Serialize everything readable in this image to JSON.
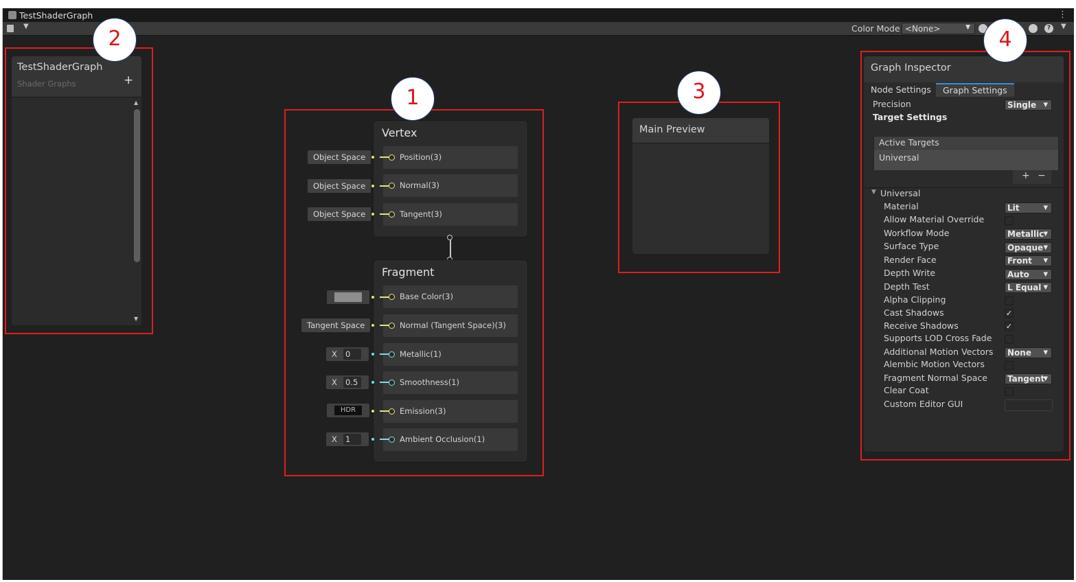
{
  "window": {
    "title": "TestShaderGraph",
    "menu_glyph": "⋮"
  },
  "toolbar": {
    "color_mode_label": "Color Mode",
    "color_mode_value": "<None>"
  },
  "blackboard": {
    "title": "TestShaderGraph",
    "subtitle": "Shader Graphs",
    "add_glyph": "+"
  },
  "vertex": {
    "title": "Vertex",
    "slots": [
      {
        "label": "Position(3)",
        "input": "Object Space"
      },
      {
        "label": "Normal(3)",
        "input": "Object Space"
      },
      {
        "label": "Tangent(3)",
        "input": "Object Space"
      }
    ]
  },
  "fragment": {
    "title": "Fragment",
    "slots": [
      {
        "label": "Base Color(3)",
        "input_type": "color-swatch"
      },
      {
        "label": "Normal (Tangent Space)(3)",
        "input": "Tangent Space"
      },
      {
        "label": "Metallic(1)",
        "x_label": "X",
        "x_value": "0"
      },
      {
        "label": "Smoothness(1)",
        "x_label": "X",
        "x_value": "0.5"
      },
      {
        "label": "Emission(3)",
        "hdr": "HDR"
      },
      {
        "label": "Ambient Occlusion(1)",
        "x_label": "X",
        "x_value": "1"
      }
    ]
  },
  "preview": {
    "title": "Main Preview"
  },
  "inspector": {
    "title": "Graph Inspector",
    "tabs": [
      "Node Settings",
      "Graph Settings"
    ],
    "active_tab": "Graph Settings",
    "precision_label": "Precision",
    "precision_value": "Single",
    "target_settings_label": "Target Settings",
    "active_targets_label": "Active Targets",
    "active_target_item": "Universal",
    "add_glyph": "+",
    "remove_glyph": "−",
    "section": "Universal",
    "dropdowns": [
      {
        "label": "Material",
        "value": "Lit"
      },
      {
        "label": "Workflow Mode",
        "value": "Metallic"
      },
      {
        "label": "Surface Type",
        "value": "Opaque"
      },
      {
        "label": "Render Face",
        "value": "Front"
      },
      {
        "label": "Depth Write",
        "value": "Auto"
      },
      {
        "label": "Depth Test",
        "value": "L Equal"
      },
      {
        "label": "Additional Motion Vectors",
        "value": "None"
      },
      {
        "label": "Fragment Normal Space",
        "value": "Tangent"
      }
    ],
    "toggles": [
      {
        "label": "Allow Material Override",
        "checked": false
      },
      {
        "label": "Alpha Clipping",
        "checked": false
      },
      {
        "label": "Cast Shadows",
        "checked": true
      },
      {
        "label": "Receive Shadows",
        "checked": true
      },
      {
        "label": "Supports LOD Cross Fade",
        "checked": false
      },
      {
        "label": "Alembic Motion Vectors",
        "checked": false
      },
      {
        "label": "Clear Coat",
        "checked": false
      }
    ],
    "custom_editor_label": "Custom Editor GUI",
    "check_glyph": "✓"
  },
  "annotations": {
    "m1": "1",
    "m2": "2",
    "m3": "3",
    "m4": "4"
  },
  "colors": {
    "annotation": "#e01e1e",
    "port_vector": "#e8e37a",
    "port_float": "#7fdbe8",
    "tab_accent": "#3c8cdf"
  }
}
